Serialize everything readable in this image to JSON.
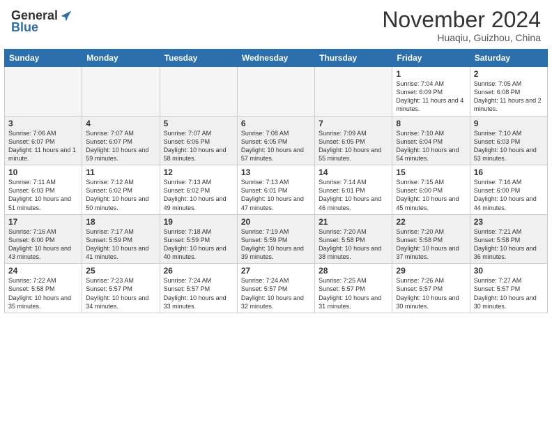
{
  "header": {
    "logo_general": "General",
    "logo_blue": "Blue",
    "month_title": "November 2024",
    "location": "Huaqiu, Guizhou, China"
  },
  "weekdays": [
    "Sunday",
    "Monday",
    "Tuesday",
    "Wednesday",
    "Thursday",
    "Friday",
    "Saturday"
  ],
  "weeks": [
    [
      {
        "day": "",
        "empty": true
      },
      {
        "day": "",
        "empty": true
      },
      {
        "day": "",
        "empty": true
      },
      {
        "day": "",
        "empty": true
      },
      {
        "day": "",
        "empty": true
      },
      {
        "day": "1",
        "info": "Sunrise: 7:04 AM\nSunset: 6:09 PM\nDaylight: 11 hours and 4 minutes."
      },
      {
        "day": "2",
        "info": "Sunrise: 7:05 AM\nSunset: 6:08 PM\nDaylight: 11 hours and 2 minutes."
      }
    ],
    [
      {
        "day": "3",
        "info": "Sunrise: 7:06 AM\nSunset: 6:07 PM\nDaylight: 11 hours and 1 minute."
      },
      {
        "day": "4",
        "info": "Sunrise: 7:07 AM\nSunset: 6:07 PM\nDaylight: 10 hours and 59 minutes."
      },
      {
        "day": "5",
        "info": "Sunrise: 7:07 AM\nSunset: 6:06 PM\nDaylight: 10 hours and 58 minutes."
      },
      {
        "day": "6",
        "info": "Sunrise: 7:08 AM\nSunset: 6:05 PM\nDaylight: 10 hours and 57 minutes."
      },
      {
        "day": "7",
        "info": "Sunrise: 7:09 AM\nSunset: 6:05 PM\nDaylight: 10 hours and 55 minutes."
      },
      {
        "day": "8",
        "info": "Sunrise: 7:10 AM\nSunset: 6:04 PM\nDaylight: 10 hours and 54 minutes."
      },
      {
        "day": "9",
        "info": "Sunrise: 7:10 AM\nSunset: 6:03 PM\nDaylight: 10 hours and 53 minutes."
      }
    ],
    [
      {
        "day": "10",
        "info": "Sunrise: 7:11 AM\nSunset: 6:03 PM\nDaylight: 10 hours and 51 minutes."
      },
      {
        "day": "11",
        "info": "Sunrise: 7:12 AM\nSunset: 6:02 PM\nDaylight: 10 hours and 50 minutes."
      },
      {
        "day": "12",
        "info": "Sunrise: 7:13 AM\nSunset: 6:02 PM\nDaylight: 10 hours and 49 minutes."
      },
      {
        "day": "13",
        "info": "Sunrise: 7:13 AM\nSunset: 6:01 PM\nDaylight: 10 hours and 47 minutes."
      },
      {
        "day": "14",
        "info": "Sunrise: 7:14 AM\nSunset: 6:01 PM\nDaylight: 10 hours and 46 minutes."
      },
      {
        "day": "15",
        "info": "Sunrise: 7:15 AM\nSunset: 6:00 PM\nDaylight: 10 hours and 45 minutes."
      },
      {
        "day": "16",
        "info": "Sunrise: 7:16 AM\nSunset: 6:00 PM\nDaylight: 10 hours and 44 minutes."
      }
    ],
    [
      {
        "day": "17",
        "info": "Sunrise: 7:16 AM\nSunset: 6:00 PM\nDaylight: 10 hours and 43 minutes."
      },
      {
        "day": "18",
        "info": "Sunrise: 7:17 AM\nSunset: 5:59 PM\nDaylight: 10 hours and 41 minutes."
      },
      {
        "day": "19",
        "info": "Sunrise: 7:18 AM\nSunset: 5:59 PM\nDaylight: 10 hours and 40 minutes."
      },
      {
        "day": "20",
        "info": "Sunrise: 7:19 AM\nSunset: 5:59 PM\nDaylight: 10 hours and 39 minutes."
      },
      {
        "day": "21",
        "info": "Sunrise: 7:20 AM\nSunset: 5:58 PM\nDaylight: 10 hours and 38 minutes."
      },
      {
        "day": "22",
        "info": "Sunrise: 7:20 AM\nSunset: 5:58 PM\nDaylight: 10 hours and 37 minutes."
      },
      {
        "day": "23",
        "info": "Sunrise: 7:21 AM\nSunset: 5:58 PM\nDaylight: 10 hours and 36 minutes."
      }
    ],
    [
      {
        "day": "24",
        "info": "Sunrise: 7:22 AM\nSunset: 5:58 PM\nDaylight: 10 hours and 35 minutes."
      },
      {
        "day": "25",
        "info": "Sunrise: 7:23 AM\nSunset: 5:57 PM\nDaylight: 10 hours and 34 minutes."
      },
      {
        "day": "26",
        "info": "Sunrise: 7:24 AM\nSunset: 5:57 PM\nDaylight: 10 hours and 33 minutes."
      },
      {
        "day": "27",
        "info": "Sunrise: 7:24 AM\nSunset: 5:57 PM\nDaylight: 10 hours and 32 minutes."
      },
      {
        "day": "28",
        "info": "Sunrise: 7:25 AM\nSunset: 5:57 PM\nDaylight: 10 hours and 31 minutes."
      },
      {
        "day": "29",
        "info": "Sunrise: 7:26 AM\nSunset: 5:57 PM\nDaylight: 10 hours and 30 minutes."
      },
      {
        "day": "30",
        "info": "Sunrise: 7:27 AM\nSunset: 5:57 PM\nDaylight: 10 hours and 30 minutes."
      }
    ]
  ]
}
